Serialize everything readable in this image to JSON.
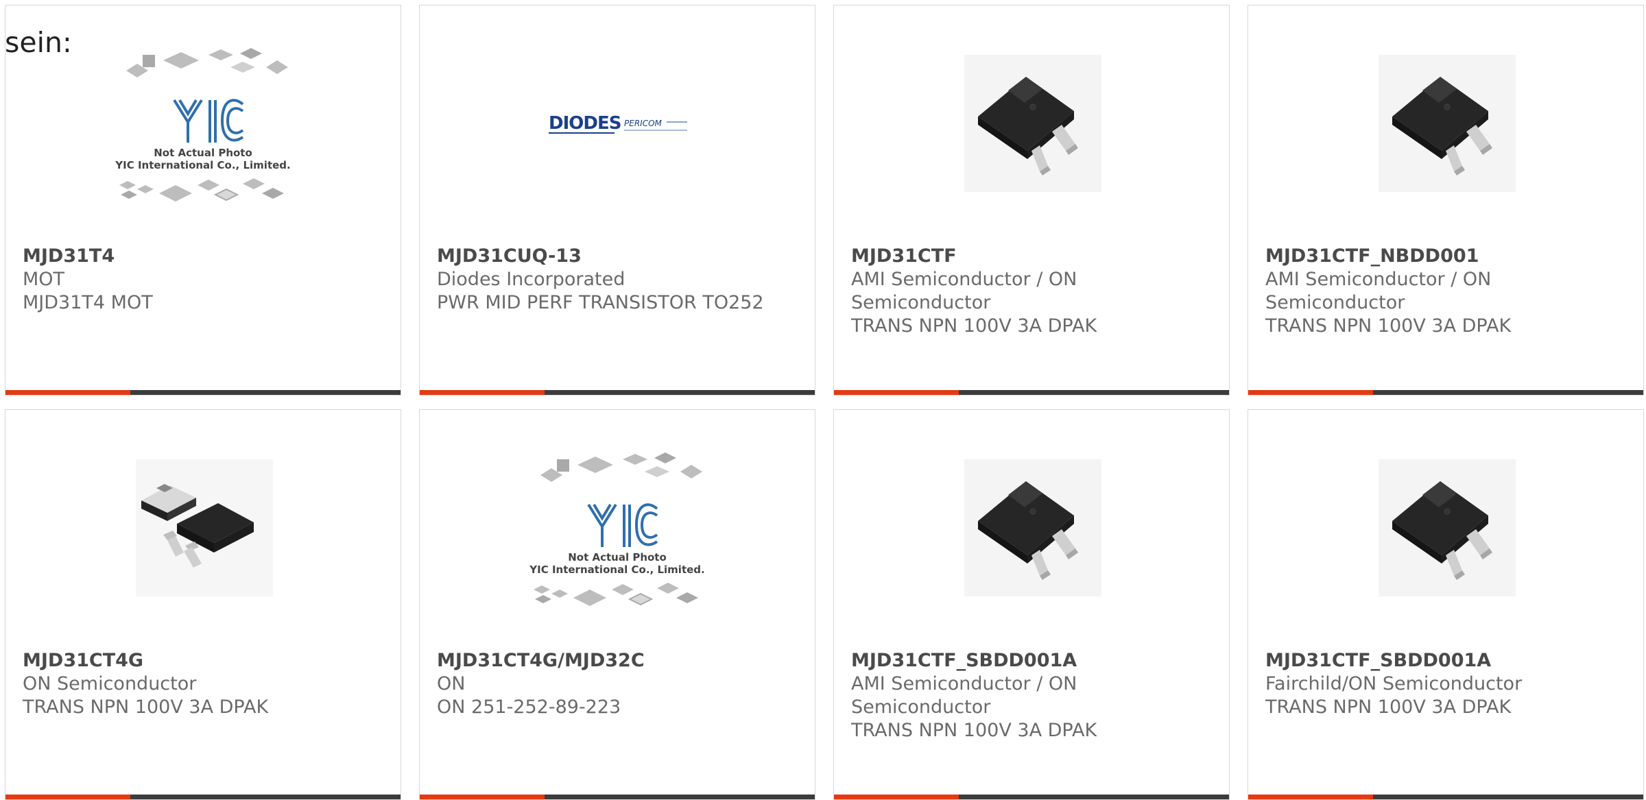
{
  "page": {
    "label": "sein:"
  },
  "theme": {
    "accent": "#e53a12",
    "bar": "#3c3c3c",
    "title_color": "#4a4a4a",
    "text_color": "#6a6a6a",
    "yic_blue": "#2f6fae"
  },
  "placeholder_image": {
    "brand": "YIC",
    "caption_1": "Not Actual Photo",
    "caption_2": "YIC International Co., Limited."
  },
  "diodes_image": {
    "brand": "DIODES",
    "sub_brand": "PERICOM"
  },
  "cards": [
    {
      "part_number": "MJD31T4",
      "manufacturer": "MOT",
      "description": "MJD31T4 MOT",
      "image": "yic-placeholder-image"
    },
    {
      "part_number": "MJD31CUQ-13",
      "manufacturer": "Diodes Incorporated",
      "description": "PWR MID PERF TRANSISTOR TO252",
      "image": "diodes-logo-image"
    },
    {
      "part_number": "MJD31CTF",
      "manufacturer": "AMI Semiconductor / ON Semiconductor",
      "description": "TRANS NPN 100V 3A DPAK",
      "image": "dpak-transistor-image"
    },
    {
      "part_number": "MJD31CTF_NBDD001",
      "manufacturer": "AMI Semiconductor / ON Semiconductor",
      "description": "TRANS NPN 100V 3A DPAK",
      "image": "dpak-transistor-image"
    },
    {
      "part_number": "MJD31CT4G",
      "manufacturer": "ON Semiconductor",
      "description": "TRANS NPN 100V 3A DPAK",
      "image": "dpak-pair-image"
    },
    {
      "part_number": "MJD31CT4G/MJD32C",
      "manufacturer": "ON",
      "description": "ON 251-252-89-223",
      "image": "yic-placeholder-image"
    },
    {
      "part_number": "MJD31CTF_SBDD001A",
      "manufacturer": "AMI Semiconductor / ON Semiconductor",
      "description": "TRANS NPN 100V 3A DPAK",
      "image": "dpak-transistor-image"
    },
    {
      "part_number": "MJD31CTF_SBDD001A",
      "manufacturer": "Fairchild/ON Semiconductor",
      "description": "TRANS NPN 100V 3A DPAK",
      "image": "dpak-transistor-image"
    }
  ]
}
